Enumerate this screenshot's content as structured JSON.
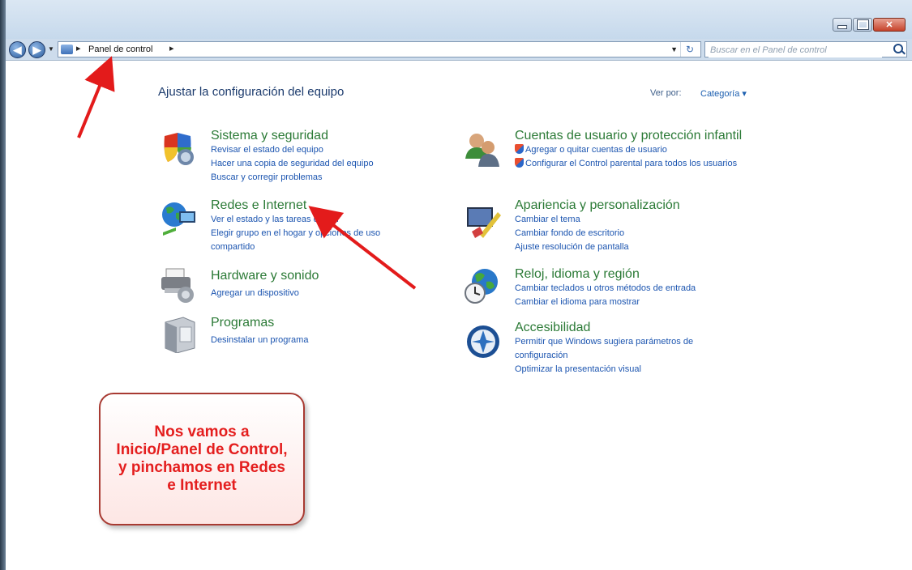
{
  "window": {
    "controls": {
      "minimize": "minimize",
      "maximize": "maximize",
      "close": "✕"
    }
  },
  "nav": {
    "breadcrumb": "Panel de control",
    "search_placeholder": "Buscar en el Panel de control"
  },
  "header": {
    "title": "Ajustar la configuración del equipo",
    "view_by_label": "Ver por:",
    "view_by_value": "Categoría ▾"
  },
  "categories_left": [
    {
      "title": "Sistema y seguridad",
      "links": [
        "Revisar el estado del equipo",
        "Hacer una copia de seguridad del equipo",
        "Buscar y corregir problemas"
      ]
    },
    {
      "title": "Redes e Internet",
      "links": [
        "Ver el estado y las tareas de red",
        "Elegir grupo en el hogar y opciones de uso compartido"
      ]
    },
    {
      "title": "Hardware y sonido",
      "links": [
        "Agregar un dispositivo"
      ]
    },
    {
      "title": "Programas",
      "links": [
        "Desinstalar un programa"
      ]
    }
  ],
  "categories_right": [
    {
      "title": "Cuentas de usuario y protección infantil",
      "links": [
        "Agregar o quitar cuentas de usuario",
        "Configurar el Control parental para todos los usuarios"
      ]
    },
    {
      "title": "Apariencia y personalización",
      "links": [
        "Cambiar el tema",
        "Cambiar fondo de escritorio",
        "Ajuste resolución de pantalla"
      ]
    },
    {
      "title": "Reloj, idioma y región",
      "links": [
        "Cambiar teclados u otros métodos de entrada",
        "Cambiar el idioma para mostrar"
      ]
    },
    {
      "title": "Accesibilidad",
      "links": [
        "Permitir que Windows sugiera parámetros de configuración",
        "Optimizar la presentación visual"
      ]
    }
  ],
  "annotation": {
    "callout_text": "Nos vamos a Inicio/Panel de Control, y pinchamos en Redes e Internet",
    "arrow_color": "#e31b1b"
  },
  "colors": {
    "category_title": "#2b7a36",
    "link": "#1c55b0",
    "titlebar": "#c6d9ec"
  }
}
